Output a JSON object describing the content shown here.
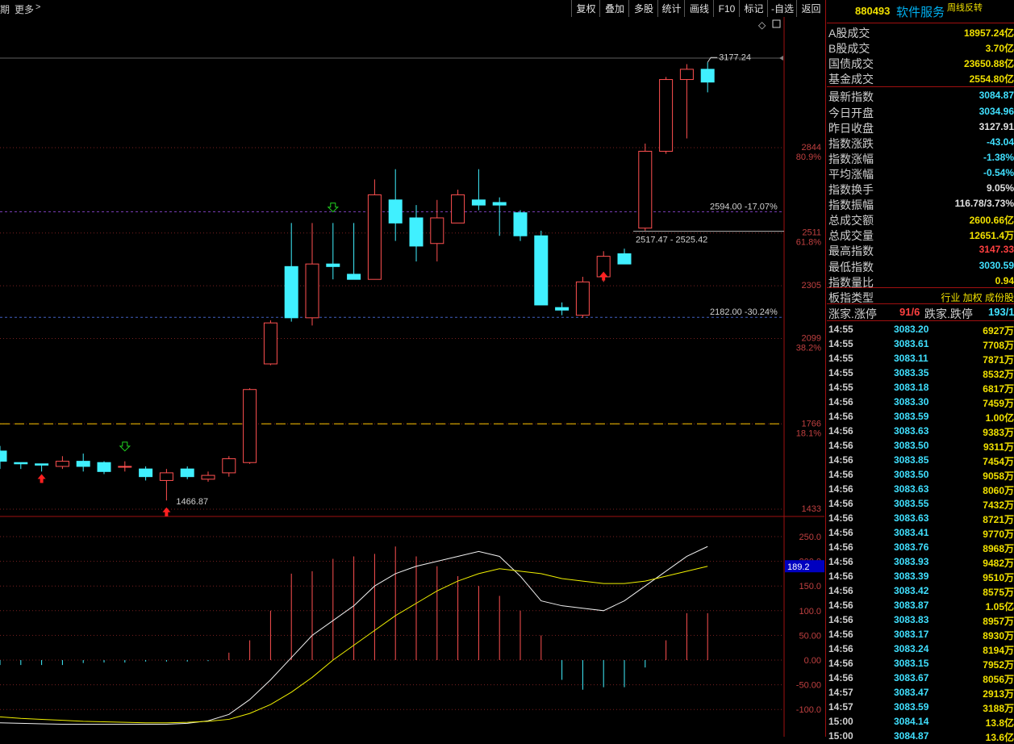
{
  "toolbar": {
    "left_cut": "期",
    "more": "更多",
    "buttons": [
      "复权",
      "叠加",
      "多股",
      "统计",
      "画线",
      "F10",
      "标记",
      "-自选",
      "返回"
    ]
  },
  "stock": {
    "code": "880493",
    "name": "软件服务",
    "flag": "周线反转"
  },
  "stats": [
    {
      "label": "A股成交",
      "value": "18957.24亿",
      "color": "#f0e000"
    },
    {
      "label": "B股成交",
      "value": "3.70亿",
      "color": "#f0e000"
    },
    {
      "label": "国债成交",
      "value": "23650.88亿",
      "color": "#f0e000"
    },
    {
      "label": "基金成交",
      "value": "2554.80亿",
      "color": "#f0e000"
    },
    {
      "label": "最新指数",
      "value": "3084.87",
      "color": "#40e0ff"
    },
    {
      "label": "今日开盘",
      "value": "3034.96",
      "color": "#40e0ff"
    },
    {
      "label": "昨日收盘",
      "value": "3127.91",
      "color": "#e0e0e0"
    },
    {
      "label": "指数涨跌",
      "value": "-43.04",
      "color": "#40e0ff"
    },
    {
      "label": "指数涨幅",
      "value": "-1.38%",
      "color": "#40e0ff"
    },
    {
      "label": "平均涨幅",
      "value": "-0.54%",
      "color": "#40e0ff"
    },
    {
      "label": "指数换手",
      "value": "9.05%",
      "color": "#e0e0e0"
    },
    {
      "label": "指数振幅",
      "value": "116.78/3.73%",
      "color": "#e0e0e0"
    },
    {
      "label": "总成交额",
      "value": "2600.66亿",
      "color": "#f0e000"
    },
    {
      "label": "总成交量",
      "value": "12651.4万",
      "color": "#f0e000"
    },
    {
      "label": "最高指数",
      "value": "3147.33",
      "color": "#ff4040"
    },
    {
      "label": "最低指数",
      "value": "3030.59",
      "color": "#40e0ff"
    },
    {
      "label": "指数量比",
      "value": "0.94",
      "color": "#f0e000"
    }
  ],
  "index_type": {
    "label": "板指类型",
    "value": "行业 加权 成份股"
  },
  "breadth": {
    "up_label": "涨家.涨停",
    "up_value": "91/6",
    "down_label": "跌家.跌停",
    "down_value": "193/1"
  },
  "ticks": [
    {
      "t": "14:55",
      "p": "3083.20",
      "v": "6927万"
    },
    {
      "t": "14:55",
      "p": "3083.61",
      "v": "7708万"
    },
    {
      "t": "14:55",
      "p": "3083.11",
      "v": "7871万"
    },
    {
      "t": "14:55",
      "p": "3083.35",
      "v": "8532万"
    },
    {
      "t": "14:55",
      "p": "3083.18",
      "v": "6817万"
    },
    {
      "t": "14:56",
      "p": "3083.30",
      "v": "7459万"
    },
    {
      "t": "14:56",
      "p": "3083.59",
      "v": "1.00亿"
    },
    {
      "t": "14:56",
      "p": "3083.63",
      "v": "9383万"
    },
    {
      "t": "14:56",
      "p": "3083.50",
      "v": "9311万"
    },
    {
      "t": "14:56",
      "p": "3083.85",
      "v": "7454万"
    },
    {
      "t": "14:56",
      "p": "3083.50",
      "v": "9058万"
    },
    {
      "t": "14:56",
      "p": "3083.63",
      "v": "8060万"
    },
    {
      "t": "14:56",
      "p": "3083.55",
      "v": "7432万"
    },
    {
      "t": "14:56",
      "p": "3083.63",
      "v": "8721万"
    },
    {
      "t": "14:56",
      "p": "3083.41",
      "v": "9770万"
    },
    {
      "t": "14:56",
      "p": "3083.76",
      "v": "8968万"
    },
    {
      "t": "14:56",
      "p": "3083.93",
      "v": "9482万"
    },
    {
      "t": "14:56",
      "p": "3083.39",
      "v": "9510万"
    },
    {
      "t": "14:56",
      "p": "3083.42",
      "v": "8575万"
    },
    {
      "t": "14:56",
      "p": "3083.87",
      "v": "1.05亿"
    },
    {
      "t": "14:56",
      "p": "3083.83",
      "v": "8957万"
    },
    {
      "t": "14:56",
      "p": "3083.17",
      "v": "8930万"
    },
    {
      "t": "14:56",
      "p": "3083.24",
      "v": "8194万"
    },
    {
      "t": "14:56",
      "p": "3083.15",
      "v": "7952万"
    },
    {
      "t": "14:56",
      "p": "3083.67",
      "v": "8056万"
    },
    {
      "t": "14:57",
      "p": "3083.47",
      "v": "2913万"
    },
    {
      "t": "14:57",
      "p": "3083.59",
      "v": "3188万"
    },
    {
      "t": "15:00",
      "p": "3084.14",
      "v": "13.8亿"
    },
    {
      "t": "15:00",
      "p": "3084.87",
      "v": "13.6亿"
    }
  ],
  "chart_data": {
    "type": "candlestick",
    "price_axis": {
      "labels": [
        "2844",
        "2511",
        "2305",
        "2099",
        "1766",
        "1433"
      ],
      "ylim": [
        1380,
        3230
      ]
    },
    "fib_levels": [
      {
        "price": 2844,
        "pct": "80.9%"
      },
      {
        "price": 2511,
        "pct": "61.8%"
      },
      {
        "price": 2099,
        "pct": "38.2%"
      },
      {
        "price": 1766,
        "pct": "18.1%"
      }
    ],
    "candles": [
      [
        1660,
        1620,
        1680,
        1590
      ],
      [
        1615,
        1610,
        1615,
        1590
      ],
      [
        1610,
        1605,
        1605,
        1580
      ],
      [
        1600,
        1620,
        1640,
        1590
      ],
      [
        1620,
        1600,
        1650,
        1580
      ],
      [
        1615,
        1580,
        1620,
        1570
      ],
      [
        1600,
        1600,
        1620,
        1580
      ],
      [
        1590,
        1560,
        1600,
        1545
      ],
      [
        1545,
        1575,
        1590,
        1467
      ],
      [
        1590,
        1560,
        1600,
        1550
      ],
      [
        1550,
        1565,
        1580,
        1540
      ],
      [
        1575,
        1630,
        1640,
        1560
      ],
      [
        1615,
        1900,
        1905,
        1610
      ],
      [
        2000,
        2160,
        2170,
        1995
      ],
      [
        2380,
        2180,
        2550,
        2165
      ],
      [
        2180,
        2390,
        2550,
        2150
      ],
      [
        2390,
        2380,
        2550,
        2330
      ],
      [
        2350,
        2330,
        2550,
        2330
      ],
      [
        2330,
        2660,
        2720,
        2330
      ],
      [
        2640,
        2550,
        2760,
        2480
      ],
      [
        2570,
        2460,
        2620,
        2400
      ],
      [
        2470,
        2570,
        2640,
        2400
      ],
      [
        2550,
        2660,
        2680,
        2550
      ],
      [
        2640,
        2620,
        2760,
        2600
      ],
      [
        2630,
        2620,
        2650,
        2500
      ],
      [
        2590,
        2500,
        2600,
        2480
      ],
      [
        2500,
        2230,
        2520,
        2230
      ],
      [
        2220,
        2210,
        2240,
        2190
      ],
      [
        2190,
        2320,
        2340,
        2180
      ],
      [
        2340,
        2420,
        2440,
        2320
      ],
      [
        2430,
        2390,
        2450,
        2390
      ],
      [
        2530,
        2830,
        2860,
        2520
      ],
      [
        2830,
        3110,
        3120,
        2820
      ],
      [
        3110,
        3150,
        3170,
        2880
      ],
      [
        3150,
        3100,
        3177,
        3060
      ]
    ],
    "h_lines": [
      {
        "price": 2594.0,
        "label": "2594.00 -17.07%"
      },
      {
        "price": 2182.0,
        "label": "2182.00 -30.24%"
      },
      {
        "price": 2517.47,
        "label": "2517.47 - 2525.42"
      }
    ],
    "annotations": [
      "3177.24",
      "1466.87"
    ],
    "macd": {
      "axis_labels": [
        "250.0",
        "200.0",
        "150.0",
        "100.0",
        "50.00",
        "0.00",
        "-50.00",
        "-100.0"
      ],
      "ylim": [
        -130,
        280
      ],
      "current": "189.2",
      "hist": [
        -10,
        -10,
        -10,
        -10,
        -6,
        -5,
        -5,
        -3,
        -3,
        -3,
        -2,
        15,
        40,
        100,
        175,
        180,
        205,
        210,
        215,
        230,
        210,
        190,
        170,
        150,
        130,
        100,
        50,
        -40,
        -60,
        -55,
        -55,
        -15,
        40,
        95,
        95
      ],
      "dif": [
        -127,
        -128,
        -129,
        -130,
        -130,
        -130,
        -130,
        -130,
        -130,
        -128,
        -123,
        -110,
        -80,
        -40,
        5,
        50,
        80,
        110,
        150,
        175,
        190,
        200,
        210,
        220,
        210,
        170,
        120,
        110,
        105,
        100,
        120,
        150,
        180,
        210,
        230
      ],
      "dea": [
        -115,
        -118,
        -120,
        -122,
        -124,
        -125,
        -126,
        -127,
        -127,
        -126,
        -124,
        -120,
        -108,
        -90,
        -65,
        -35,
        0,
        30,
        60,
        90,
        115,
        140,
        160,
        175,
        185,
        180,
        175,
        165,
        160,
        155,
        155,
        160,
        170,
        180,
        190
      ]
    }
  }
}
